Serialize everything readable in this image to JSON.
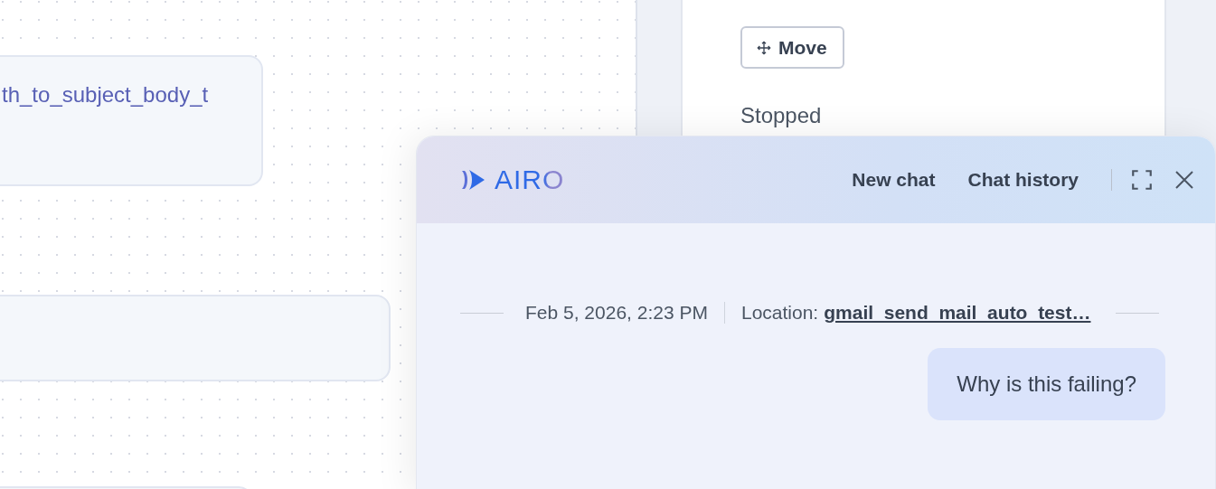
{
  "canvas": {
    "nodes": [
      {
        "label": "th_to_subject_body_t"
      }
    ]
  },
  "inspector": {
    "move_button": "Move",
    "status": "Stopped"
  },
  "chat": {
    "logo": "AIRO",
    "actions": [
      "New chat",
      "Chat history"
    ],
    "session": {
      "timestamp": "Feb 5, 2026, 2:23 PM",
      "location_label": "Location:",
      "location": "gmail_send_mail_auto_test…"
    },
    "messages": [
      {
        "kind": "user",
        "text": "Why is this failing?"
      }
    ]
  }
}
